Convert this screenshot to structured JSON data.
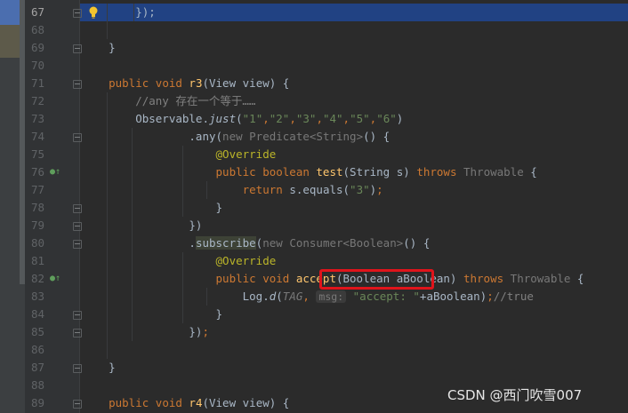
{
  "editor": {
    "lines": [
      {
        "no": "67",
        "parts": [
          {
            "t": "        });",
            "c": ""
          }
        ]
      },
      {
        "no": "68",
        "parts": []
      },
      {
        "no": "69",
        "parts": [
          {
            "t": "    }",
            "c": ""
          }
        ]
      },
      {
        "no": "70",
        "parts": []
      },
      {
        "no": "71",
        "parts": [
          {
            "t": "    ",
            "c": ""
          },
          {
            "t": "public void ",
            "c": "kw"
          },
          {
            "t": "r3",
            "c": "fn"
          },
          {
            "t": "(View view) {",
            "c": ""
          }
        ]
      },
      {
        "no": "72",
        "parts": [
          {
            "t": "        //any 存在一个等于……",
            "c": "cmt"
          }
        ]
      },
      {
        "no": "73",
        "parts": [
          {
            "t": "        Observable.",
            "c": ""
          },
          {
            "t": "just",
            "c": "it"
          },
          {
            "t": "(",
            "c": ""
          },
          {
            "t": "\"1\"",
            "c": "str"
          },
          {
            "t": ",",
            "c": "kw"
          },
          {
            "t": "\"2\"",
            "c": "str"
          },
          {
            "t": ",",
            "c": "kw"
          },
          {
            "t": "\"3\"",
            "c": "str"
          },
          {
            "t": ",",
            "c": "kw"
          },
          {
            "t": "\"4\"",
            "c": "str"
          },
          {
            "t": ",",
            "c": "kw"
          },
          {
            "t": "\"5\"",
            "c": "str"
          },
          {
            "t": ",",
            "c": "kw"
          },
          {
            "t": "\"6\"",
            "c": "str"
          },
          {
            "t": ")",
            "c": ""
          }
        ]
      },
      {
        "no": "74",
        "parts": [
          {
            "t": "                .any(",
            "c": ""
          },
          {
            "t": "new ",
            "c": "grey"
          },
          {
            "t": "Predicate<String>",
            "c": "grey"
          },
          {
            "t": "() {",
            "c": ""
          }
        ]
      },
      {
        "no": "75",
        "parts": [
          {
            "t": "                    ",
            "c": ""
          },
          {
            "t": "@Override",
            "c": "ann"
          }
        ]
      },
      {
        "no": "76",
        "parts": [
          {
            "t": "                    ",
            "c": ""
          },
          {
            "t": "public boolean ",
            "c": "kw"
          },
          {
            "t": "test",
            "c": "fn"
          },
          {
            "t": "(String s) ",
            "c": ""
          },
          {
            "t": "throws ",
            "c": "kw"
          },
          {
            "t": "Throwable",
            "c": "grey"
          },
          {
            "t": " {",
            "c": ""
          }
        ]
      },
      {
        "no": "77",
        "parts": [
          {
            "t": "                        ",
            "c": ""
          },
          {
            "t": "return ",
            "c": "kw"
          },
          {
            "t": "s.equals(",
            "c": ""
          },
          {
            "t": "\"3\"",
            "c": "str"
          },
          {
            "t": ")",
            "c": ""
          },
          {
            "t": ";",
            "c": "kw"
          }
        ]
      },
      {
        "no": "78",
        "parts": [
          {
            "t": "                    }",
            "c": ""
          }
        ]
      },
      {
        "no": "79",
        "parts": [
          {
            "t": "                })",
            "c": ""
          }
        ]
      },
      {
        "no": "80",
        "parts": [
          {
            "t": "                .",
            "c": ""
          },
          {
            "t": "subscribe",
            "c": "subhl"
          },
          {
            "t": "(",
            "c": ""
          },
          {
            "t": "new ",
            "c": "grey"
          },
          {
            "t": "Consumer<Boolean>",
            "c": "grey"
          },
          {
            "t": "() {",
            "c": ""
          }
        ]
      },
      {
        "no": "81",
        "parts": [
          {
            "t": "                    ",
            "c": ""
          },
          {
            "t": "@Override",
            "c": "ann"
          }
        ]
      },
      {
        "no": "82",
        "parts": [
          {
            "t": "                    ",
            "c": ""
          },
          {
            "t": "public void ",
            "c": "kw"
          },
          {
            "t": "accept",
            "c": "fn"
          },
          {
            "t": "(Boolean aBoolean) ",
            "c": ""
          },
          {
            "t": "throws ",
            "c": "kw"
          },
          {
            "t": "Throwable",
            "c": "grey"
          },
          {
            "t": " {",
            "c": ""
          }
        ]
      },
      {
        "no": "83",
        "parts": [
          {
            "t": "                        Log.",
            "c": ""
          },
          {
            "t": "d",
            "c": "it"
          },
          {
            "t": "(",
            "c": ""
          },
          {
            "t": "TAG",
            "c": "it grey"
          },
          {
            "t": ", ",
            "c": "kw"
          },
          {
            "t": "msg:",
            "c": "hint"
          },
          {
            "t": " \"accept: \"",
            "c": "str"
          },
          {
            "t": "+aBoolean)",
            "c": ""
          },
          {
            "t": ";",
            "c": "kw"
          },
          {
            "t": "//true",
            "c": "cmt"
          }
        ]
      },
      {
        "no": "84",
        "parts": [
          {
            "t": "                    }",
            "c": ""
          }
        ]
      },
      {
        "no": "85",
        "parts": [
          {
            "t": "                })",
            "c": ""
          },
          {
            "t": ";",
            "c": "kw"
          }
        ]
      },
      {
        "no": "86",
        "parts": []
      },
      {
        "no": "87",
        "parts": [
          {
            "t": "    }",
            "c": ""
          }
        ]
      },
      {
        "no": "88",
        "parts": []
      },
      {
        "no": "89",
        "parts": [
          {
            "t": "    ",
            "c": ""
          },
          {
            "t": "public void ",
            "c": "kw"
          },
          {
            "t": "r4",
            "c": "fn"
          },
          {
            "t": "(View view) {",
            "c": ""
          }
        ]
      }
    ]
  },
  "watermark": "CSDN @西门吹雪007"
}
